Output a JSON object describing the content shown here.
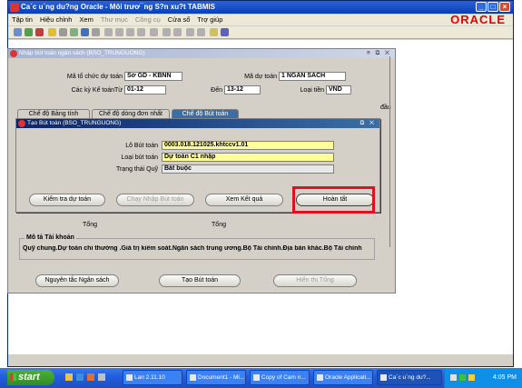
{
  "window": {
    "title": "Ca´c u´ng du?ng Oracle  -  Môi trươ¯ng S?n xu?t TABMIS",
    "logo": "ORACLE"
  },
  "menu": [
    {
      "label": "Tập tin",
      "enabled": true
    },
    {
      "label": "Hiệu chỉnh",
      "enabled": true
    },
    {
      "label": "Xem",
      "enabled": true
    },
    {
      "label": "Thư mục",
      "enabled": false
    },
    {
      "label": "Công cụ",
      "enabled": false
    },
    {
      "label": "Cửa sổ",
      "enabled": true
    },
    {
      "label": "Trợ giúp",
      "enabled": true
    }
  ],
  "main_form": {
    "title": "Nhập bút toán ngân sách (BSO_TRUNGUONG)",
    "controls": "≡ ⧉ ✕",
    "org_label": "Mã tổ chức dự toán",
    "org_value": "Sở GD - KBNN",
    "budget_code_label": "Mã dự toán",
    "budget_code_value": "1 NGÂN SÁCH",
    "period_from_label": "Các kỳ Kế toánTừ",
    "period_from_value": "01-12",
    "period_to_label": "Đến",
    "period_to_value": "13-12",
    "currency_label": "Loại tiền",
    "currency_value": "VND",
    "right_edge_text": "đầu",
    "tabs": [
      {
        "label": "Chế độ Bảng tính",
        "active": false
      },
      {
        "label": "Chế độ dòng đơn nhất",
        "active": false
      },
      {
        "label": "Chế độ Bút toán",
        "active": true
      }
    ],
    "hidden_label_1": "Tổng",
    "hidden_label_2": "Tổng",
    "account_desc_label": "Mô tả Tài khoản",
    "account_desc_value": "Quỹ chung.Dự toán chi thường .Giá trị kiểm soát.Ngân sách trung ương.Bộ Tài chính.Địa bàn khác.Bộ Tài chính",
    "buttons": {
      "principles": "Nguyên tắc Ngân sách",
      "create_entry": "Tạo Bút toán",
      "show_total": "Hiển thị Tổng"
    }
  },
  "dialog": {
    "title": "Tạo Bút toán (BSO_TRUNGUONG)",
    "batch_label": "Lô Bút toán",
    "batch_value": "0003.018.121025.khtccv1.01",
    "entry_type_label": "Loại bút toán",
    "entry_type_value": "Dự toán C1 nhập",
    "fund_status_label": "Trạng thái Quỹ",
    "fund_status_value": "Bắt buộc",
    "buttons": {
      "check_budget": "Kiểm tra dự toán",
      "run_entry": "Chạy Nhập Bút toán",
      "view_results": "Xem Kết quả",
      "finish": "Hoàn tất"
    }
  },
  "taskbar": {
    "start": "start",
    "tasks": [
      {
        "label": "Lan 2.11.10",
        "active": false
      },
      {
        "label": "Document1 - Mi...",
        "active": false
      },
      {
        "label": "Copy of Cam n...",
        "active": false
      },
      {
        "label": "Oracle Applicati...",
        "active": false
      },
      {
        "label": "Ca´c u´ng du?...",
        "active": true
      }
    ],
    "clock": "4:05 PM"
  },
  "colors": {
    "highlight": "#e01020",
    "oracle_red": "#e30000",
    "active_tab": "#3a6ea5",
    "field_yellow": "#ffff99"
  }
}
